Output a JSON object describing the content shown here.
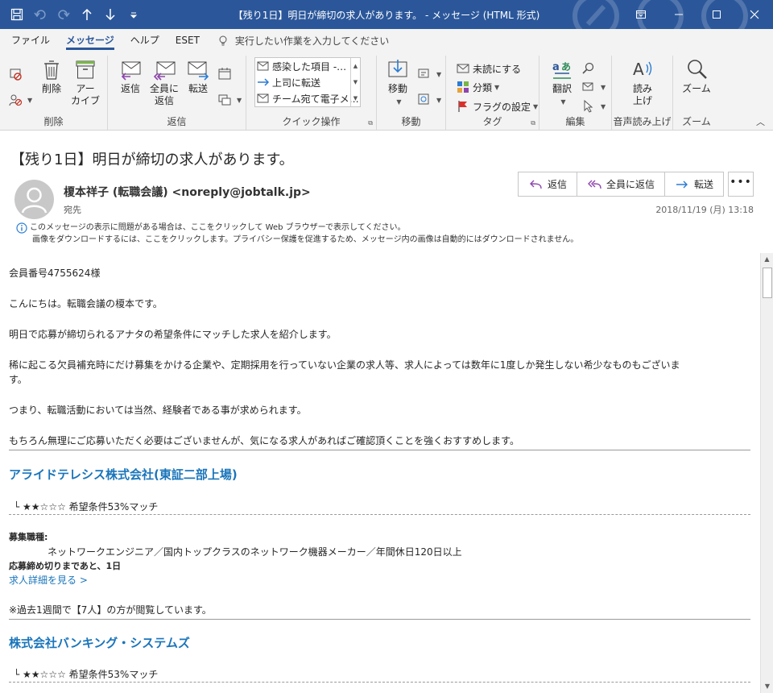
{
  "window": {
    "title": "【残り1日】明日が締切の求人があります。 - メッセージ (HTML 形式)"
  },
  "menu": {
    "tabs": [
      "ファイル",
      "メッセージ",
      "ヘルプ",
      "ESET"
    ],
    "active": "メッセージ",
    "tell_me": "実行したい作業を入力してください"
  },
  "ribbon": {
    "groups": {
      "delete": {
        "label": "削除",
        "delete_btn": "削除",
        "archive_line1": "アー",
        "archive_line2": "カイブ"
      },
      "reply": {
        "label": "返信",
        "reply": "返信",
        "reply_all_line1": "全員に",
        "reply_all_line2": "返信",
        "forward": "転送"
      },
      "quick": {
        "label": "クイック操作",
        "items": [
          "感染した項目 -…",
          "上司に転送",
          "チーム宛て電子メ…"
        ]
      },
      "move": {
        "label": "移動",
        "move": "移動"
      },
      "tags": {
        "label": "タグ",
        "unread": "未読にする",
        "categorize": "分類",
        "flag": "フラグの設定"
      },
      "edit": {
        "label": "編集",
        "translate": "翻訳"
      },
      "speech": {
        "label": "音声読み上げ",
        "read_line1": "読み",
        "read_line2": "上げ"
      },
      "zoom": {
        "label": "ズーム",
        "zoom": "ズーム"
      }
    }
  },
  "message": {
    "subject": "【残り1日】明日が締切の求人があります。",
    "sender": "榎本祥子 (転職会議) <noreply@jobtalk.jp>",
    "to_label": "宛先",
    "datetime": "2018/11/19 (月) 13:18",
    "actions": {
      "reply": "返信",
      "reply_all": "全員に返信",
      "forward": "転送"
    },
    "info_line1": "このメッセージの表示に問題がある場合は、ここをクリックして Web ブラウザーで表示してください。",
    "info_line2": "画像をダウンロードするには、ここをクリックします。プライバシー保護を促進するため、メッセージ内の画像は自動的にはダウンロードされません。"
  },
  "body": {
    "member": "会員番号4755624様",
    "greeting": "こんにちは。転職会議の榎本です。",
    "intro": "明日で応募が締切られるアナタの希望条件にマッチした求人を紹介します。",
    "para1_line1": "稀に起こる欠員補充時にだけ募集をかける企業や、定期採用を行っていない企業の求人等、求人によっては数年に1度しか発生しない希少なものもございま",
    "para1_line2": "す。",
    "para2": "つまり、転職活動においては当然、経験者である事が求められます。",
    "para3": "もちろん無理にご応募いただく必要はございませんが、気になる求人があればご確認頂くことを強くおすすめします。",
    "jobs": [
      {
        "company": "アライドテレシス株式会社(東証二部上場)",
        "match": "└ ★★☆☆☆ 希望条件53%マッチ",
        "type_label": "募集職種:",
        "type": "ネットワークエンジニア／国内トップクラスのネットワーク機器メーカー／年間休日120日以上",
        "deadline": "応募締め切りまであと、1日",
        "detail_link": "求人詳細を見る >",
        "views": "※過去1週間で【7人】の方が閲覧しています。"
      },
      {
        "company": "株式会社バンキング・システムズ",
        "match": "└ ★★☆☆☆ 希望条件53%マッチ"
      }
    ]
  }
}
